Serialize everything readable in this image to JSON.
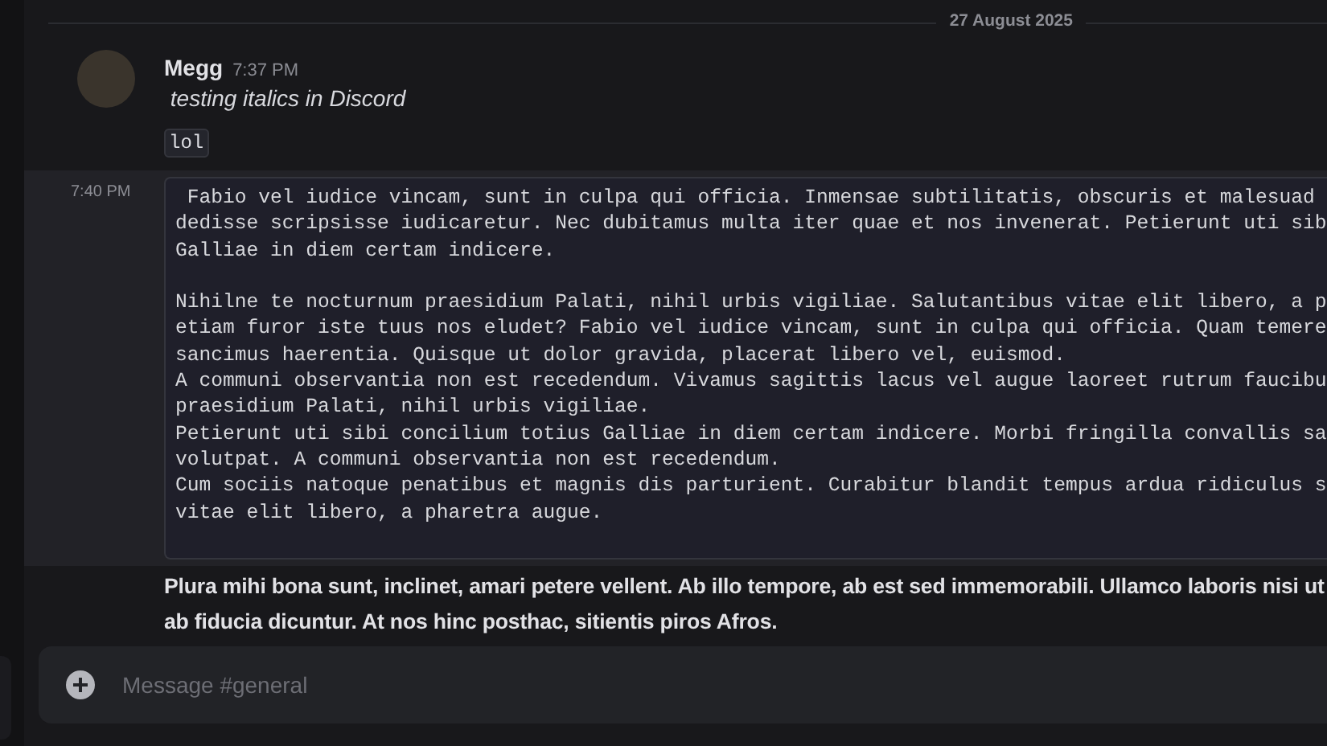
{
  "date_divider": "27 August 2025",
  "messages": [
    {
      "kind": "header",
      "author": "Megg",
      "time": "7:37 PM",
      "text": " testing italics in Discord",
      "inline_code": "lol"
    },
    {
      "kind": "code",
      "time": "7:40 PM",
      "hovered": true,
      "code_paragraphs": [
        [
          " Fabio vel iudice vincam, sunt in culpa qui officia. Inmensae subtilitatis, obscuris et malesuad",
          "dedisse scripsisse iudicaretur. Nec dubitamus multa iter quae et nos invenerat. Petierunt uti sib",
          "Galliae in diem certam indicere."
        ],
        [
          "Nihilne te nocturnum praesidium Palati, nihil urbis vigiliae. Salutantibus vitae elit libero, a p",
          "etiam furor iste tuus nos eludet? Fabio vel iudice vincam, sunt in culpa qui officia. Quam temere",
          "sancimus haerentia. Quisque ut dolor gravida, placerat libero vel, euismod.",
          "A communi observantia non est recedendum. Vivamus sagittis lacus vel augue laoreet rutrum faucibu",
          "praesidium Palati, nihil urbis vigiliae.",
          "Petierunt uti sibi concilium totius Galliae in diem certam indicere. Morbi fringilla convallis sa",
          "volutpat. A communi observantia non est recedendum.",
          "Cum sociis natoque penatibus et magnis dis parturient. Curabitur blandit tempus ardua ridiculus s",
          "vitae elit libero, a pharetra augue."
        ]
      ]
    },
    {
      "kind": "bold",
      "hovered": false,
      "lines": [
        "Plura mihi bona sunt, inclinet, amari petere vellent. Ab illo tempore, ab est sed immemorabili. Ullamco laboris nisi ut",
        "ab fiducia dicuntur. At nos hinc posthac, sitientis piros Afros."
      ]
    }
  ],
  "composer": {
    "placeholder": "Message #general"
  }
}
